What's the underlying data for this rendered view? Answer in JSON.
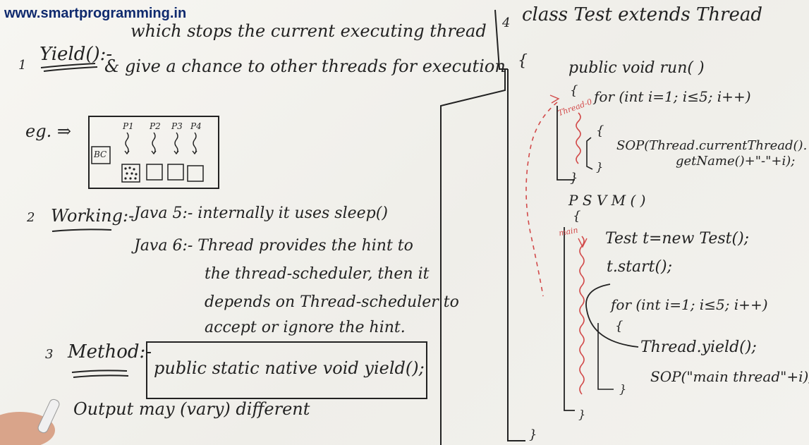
{
  "watermark": "www.smartprogramming.in",
  "left": {
    "p1": {
      "num": "1",
      "title": "Yield():-",
      "line1": "which stops the current executing thread",
      "line2": "& give a chance to other threads for execution"
    },
    "example": {
      "label": "eg. ⇒",
      "bc": "BC",
      "procs": [
        "P1",
        "P2",
        "P3",
        "P4"
      ]
    },
    "p2": {
      "num": "2",
      "title": "Working:-",
      "java5": "Java 5:- internally it uses sleep()",
      "java6_1": "Java 6:- Thread provides the hint to",
      "java6_2": "the thread-scheduler, then it",
      "java6_3": "depends on Thread-scheduler to",
      "java6_4": "accept or ignore the hint."
    },
    "p3": {
      "num": "3",
      "title": "Method:-",
      "signature": "public static native void yield();"
    },
    "p4": {
      "text": "Output may (vary) different"
    }
  },
  "right": {
    "num": "4",
    "l1": "class Test extends Thread",
    "l2": "{",
    "l3": "public void run( )",
    "l4": "{",
    "l5": "for (int i=1; i≤5; i++)",
    "l6": "{",
    "l7": "SOP(Thread.currentThread().",
    "l8": "getName()+\"-\"+i);",
    "l9": "}",
    "l10": "}",
    "l11": "P S V M (          )",
    "l12": "{",
    "l13": "Test t=new Test();",
    "l14": "t.start();",
    "l15": "for (int i=1; i≤5; i++)",
    "l16": "{",
    "l17": "Thread.yield();",
    "l18": "SOP(\"main thread\"+i);",
    "l19": "}",
    "l20": "}",
    "l21": "}",
    "thread0_label": "Thread-0",
    "main_label": "main"
  },
  "colors": {
    "ink": "#222222",
    "red_marker": "#d24a4a",
    "watermark": "#0f2a6e",
    "board": "#f4f3ef"
  }
}
